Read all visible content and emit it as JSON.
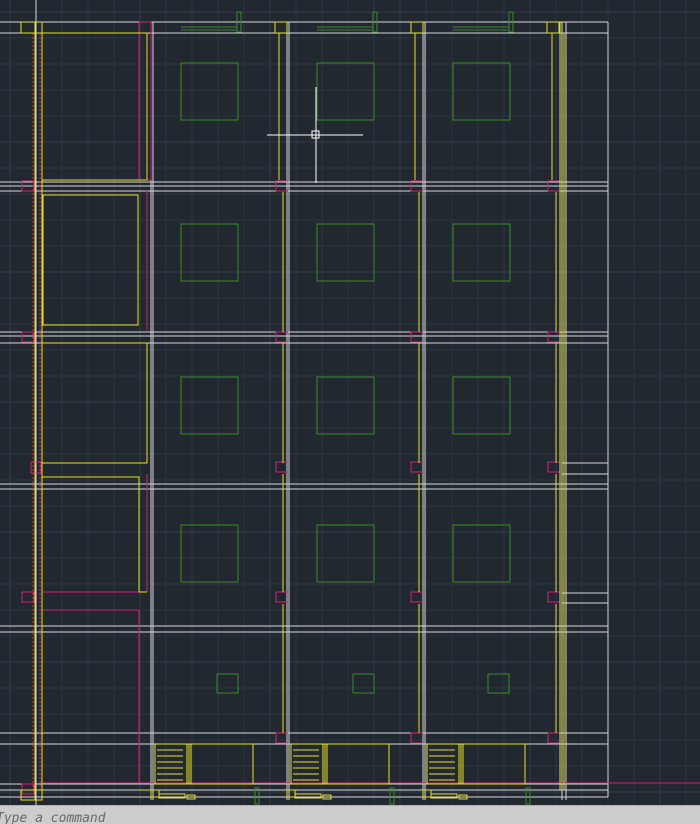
{
  "command_line": {
    "placeholder": "Type a command"
  },
  "colors": {
    "background": "#212830",
    "grid_minor": "#2b3340",
    "grid_major": "#323c4a",
    "white_lines": "#d8d8d8",
    "yellow_lines": "#e8e020",
    "magenta_lines": "#d0207a",
    "green_lines": "#3a8a2a",
    "red_dashed": "#e03030",
    "crosshair": "#ffffff"
  },
  "icons": {
    "crosshair": "crosshair-cursor-icon"
  }
}
